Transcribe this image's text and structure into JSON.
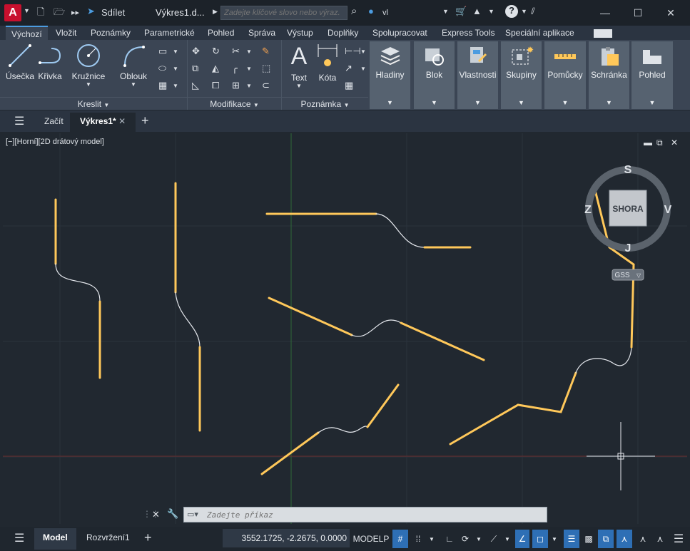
{
  "titlebar": {
    "share_label": "Sdílet",
    "doc_title": "Výkres1.d...",
    "search_placeholder": "Zadejte klíčové slovo nebo výraz.",
    "user_label": "vl",
    "logo_letter": "A"
  },
  "menu": {
    "tabs": [
      "Výchozí",
      "Vložit",
      "Poznámky",
      "Parametrické",
      "Pohled",
      "Správa",
      "Výstup",
      "Doplňky",
      "Spolupracovat",
      "Express Tools",
      "Speciální aplikace"
    ]
  },
  "ribbon": {
    "draw": {
      "line": "Úsečka",
      "polyline": "Křivka",
      "circle": "Kružnice",
      "arc": "Oblouk",
      "footer": "Kreslit"
    },
    "modify": {
      "footer": "Modifikace"
    },
    "annotation": {
      "text": "Text",
      "dimension": "Kóta",
      "footer": "Poznámka"
    },
    "tiles": [
      "Hladiny",
      "Blok",
      "Vlastnosti",
      "Skupiny",
      "Pomůcky",
      "Schránka",
      "Pohled"
    ]
  },
  "doc_tabs": {
    "start": "Začít",
    "active": "Výkres1*"
  },
  "viewport": {
    "label": "[−][Horní][2D drátový model]",
    "viewcube": {
      "face": "SHORA",
      "north": "S",
      "south": "J",
      "east": "V",
      "west": "Z",
      "ucs": "GSS"
    }
  },
  "command": {
    "placeholder": "Zadejte příkaz"
  },
  "status": {
    "model_tab": "Model",
    "layout_tab": "Rozvržení1",
    "coordinates": "3552.1725, -2.2675, 0.0000",
    "space": "MODELP"
  },
  "colors": {
    "accent": "#2e6fb5",
    "geometry": "#ffc85a",
    "curve": "#e6e9ee"
  }
}
